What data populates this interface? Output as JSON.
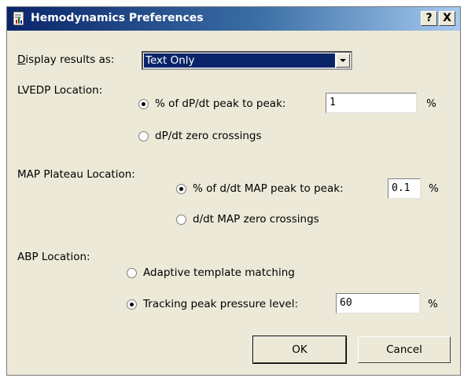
{
  "window": {
    "title": "Hemodynamics Preferences",
    "help_btn": "?",
    "close_btn": "X",
    "icon": "document-chart-icon"
  },
  "display": {
    "label": "Display results as:",
    "selected": "Text Only"
  },
  "lvedp": {
    "label": "LVEDP Location:",
    "opt1": "% of dP/dt peak to peak:",
    "opt1_value": "1",
    "opt1_unit": "%",
    "opt1_checked": true,
    "opt2": "dP/dt zero crossings",
    "opt2_checked": false
  },
  "map": {
    "label": "MAP Plateau Location:",
    "opt1": "% of d/dt MAP peak to peak:",
    "opt1_value": "0.1",
    "opt1_unit": "%",
    "opt1_checked": true,
    "opt2": "d/dt MAP zero crossings",
    "opt2_checked": false
  },
  "abp": {
    "label": "ABP Location:",
    "opt1": "Adaptive template matching",
    "opt1_checked": false,
    "opt2": "Tracking peak pressure level:",
    "opt2_value": "60",
    "opt2_unit": "%",
    "opt2_checked": true
  },
  "buttons": {
    "ok": "OK",
    "cancel": "Cancel"
  }
}
